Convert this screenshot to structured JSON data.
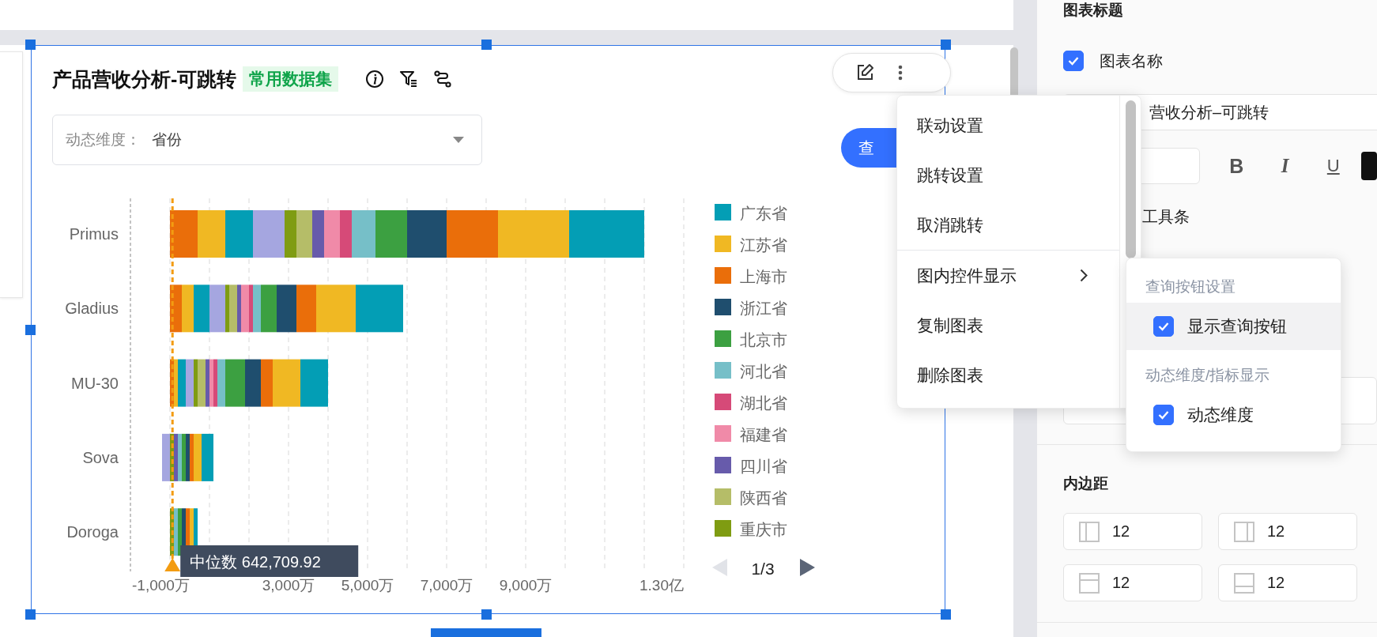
{
  "chart_card": {
    "title": "产品营收分析-可跳转",
    "tag": "常用数据集",
    "dimension_select": {
      "label": "动态维度：",
      "value": "省份"
    },
    "query_button": {
      "label": "查"
    },
    "chart_data": {
      "type": "bar",
      "orientation": "horizontal",
      "stacked": true,
      "categories": [
        "Primus",
        "Gladius",
        "MU-30",
        "Sova",
        "Doroga"
      ],
      "grid": true,
      "legend": true,
      "xlim": [
        -1000,
        13000
      ],
      "xticks": [
        {
          "value": -1000,
          "label": "-1,000万"
        },
        {
          "value": 3000,
          "label": "3,000万"
        },
        {
          "value": 5000,
          "label": "5,000万"
        },
        {
          "value": 7000,
          "label": "7,000万"
        },
        {
          "value": 9000,
          "label": "9,000万"
        }
      ],
      "series": [
        {
          "name": "广东省",
          "color": "#039eb5",
          "values": [
            1900,
            1200,
            700,
            300,
            100
          ]
        },
        {
          "name": "江苏省",
          "color": "#f0b823",
          "values": [
            1800,
            1000,
            700,
            200,
            100
          ]
        },
        {
          "name": "上海市",
          "color": "#ea6e0a",
          "values": [
            1300,
            500,
            300,
            100,
            100
          ]
        },
        {
          "name": "浙江省",
          "color": "#1f4e6e",
          "values": [
            1000,
            500,
            400,
            100,
            100
          ]
        },
        {
          "name": "北京市",
          "color": "#3ca041",
          "values": [
            800,
            400,
            500,
            100,
            100
          ]
        },
        {
          "name": "河北省",
          "color": "#76bfc8",
          "values": [
            600,
            200,
            200,
            100,
            100
          ]
        },
        {
          "name": "湖北省",
          "color": "#d64a78",
          "values": [
            300,
            100,
            100,
            0,
            0
          ]
        },
        {
          "name": "福建省",
          "color": "#f08aa8",
          "values": [
            400,
            200,
            100,
            0,
            0
          ]
        },
        {
          "name": "四川省",
          "color": "#675bab",
          "values": [
            300,
            100,
            100,
            100,
            0
          ]
        },
        {
          "name": "陕西省",
          "color": "#b5bd68",
          "values": [
            400,
            200,
            200,
            0,
            0
          ]
        },
        {
          "name": "重庆市",
          "color": "#7f9c12",
          "values": [
            300,
            100,
            100,
            100,
            100
          ]
        },
        {
          "color": "#a5a6e0",
          "values": [
            800,
            400,
            200,
            -200,
            0
          ]
        },
        {
          "color": "#039eb5",
          "values": [
            700,
            400,
            200,
            0,
            0
          ]
        },
        {
          "color": "#f0b823",
          "values": [
            700,
            300,
            100,
            0,
            0
          ]
        },
        {
          "color": "#ea6e0a",
          "values": [
            700,
            300,
            100,
            0,
            0
          ]
        }
      ],
      "ref_lines": [
        {
          "axis": "x",
          "value": 64.27,
          "label": "中位数 642,709.92"
        }
      ]
    },
    "axis_end_label": "1.30亿",
    "legend_pager": {
      "text": "1/3",
      "prev_disabled": true,
      "next_disabled": false
    }
  },
  "context_menu": {
    "groups": [
      {
        "items": [
          {
            "label": "联动设置",
            "has_submenu": false
          },
          {
            "label": "跳转设置",
            "has_submenu": false
          },
          {
            "label": "取消跳转",
            "has_submenu": false
          }
        ]
      },
      {
        "items": [
          {
            "label": "图内控件显示",
            "has_submenu": true
          },
          {
            "label": "复制图表",
            "has_submenu": false
          },
          {
            "label": "删除图表",
            "has_submenu": false
          }
        ]
      }
    ]
  },
  "submenu": {
    "sections": [
      {
        "heading": "查询按钮设置",
        "items": [
          {
            "label": "显示查询按钮",
            "checked": true,
            "highlighted": true
          }
        ]
      },
      {
        "heading": "动态维度/指标显示",
        "items": [
          {
            "label": "动态维度",
            "checked": true,
            "highlighted": false
          }
        ]
      }
    ]
  },
  "properties_panel": {
    "title_heading": "图表标题",
    "show_name": {
      "label": "图表名称",
      "checked": true
    },
    "name_field": {
      "value": "营收分析–可跳转"
    },
    "format_buttons": [
      {
        "label": "B",
        "kind": "bold"
      },
      {
        "label": "I",
        "kind": "italic"
      },
      {
        "label": "U",
        "kind": "underline"
      }
    ],
    "toolbar_label": "工具条",
    "padding_heading": "内边距",
    "padding_fields": [
      {
        "kind": "left",
        "value": "12"
      },
      {
        "kind": "right",
        "value": "12"
      },
      {
        "kind": "top",
        "value": "12"
      },
      {
        "kind": "bottom",
        "value": "12"
      }
    ]
  }
}
